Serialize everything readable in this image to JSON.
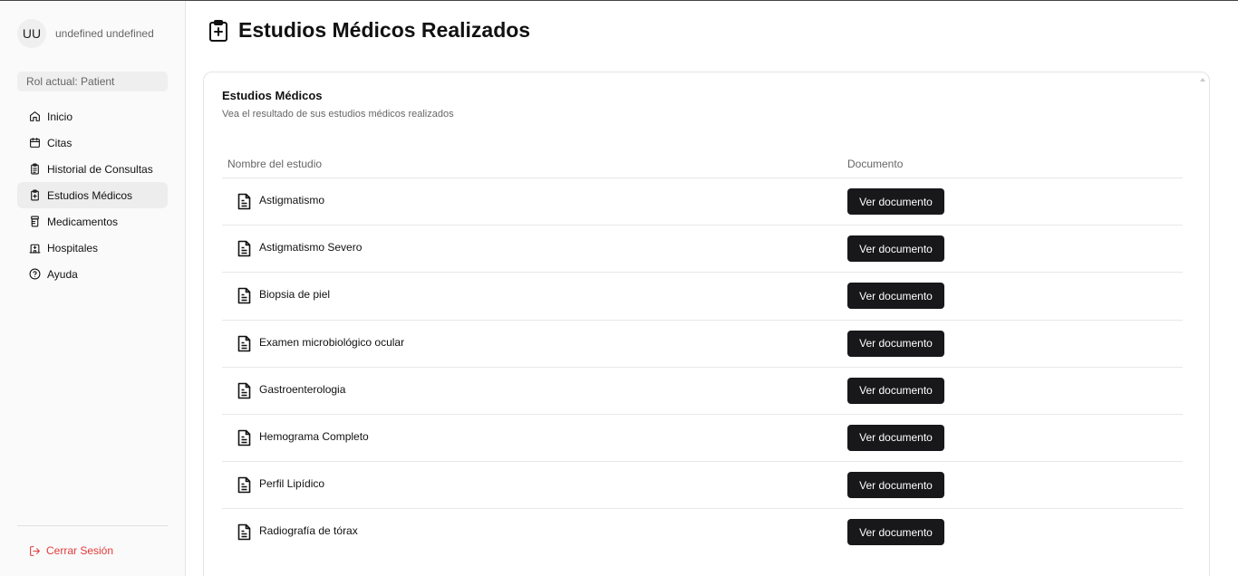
{
  "user": {
    "initials": "UU",
    "name": "undefined undefined"
  },
  "role_label": "Rol actual: Patient",
  "nav": [
    {
      "label": "Inicio",
      "icon": "home-icon",
      "active": false
    },
    {
      "label": "Citas",
      "icon": "calendar-icon",
      "active": false
    },
    {
      "label": "Historial de Consultas",
      "icon": "clipboard-list-icon",
      "active": false
    },
    {
      "label": "Estudios Médicos",
      "icon": "clipboard-plus-icon",
      "active": true
    },
    {
      "label": "Medicamentos",
      "icon": "pill-bottle-icon",
      "active": false
    },
    {
      "label": "Hospitales",
      "icon": "hospital-icon",
      "active": false
    },
    {
      "label": "Ayuda",
      "icon": "help-circle-icon",
      "active": false
    }
  ],
  "logout_label": "Cerrar Sesión",
  "page_title": "Estudios Médicos Realizados",
  "card": {
    "title": "Estudios Médicos",
    "subtitle": "Vea el resultado de sus estudios médicos realizados",
    "columns": [
      "Nombre del estudio",
      "Documento"
    ],
    "rows": [
      {
        "name": "Astigmatismo",
        "action": "Ver documento"
      },
      {
        "name": "Astigmatismo Severo",
        "action": "Ver documento"
      },
      {
        "name": "Biopsia de piel",
        "action": "Ver documento"
      },
      {
        "name": "Examen microbiológico ocular",
        "action": "Ver documento"
      },
      {
        "name": "Gastroenterologia",
        "action": "Ver documento"
      },
      {
        "name": "Hemograma Completo",
        "action": "Ver documento"
      },
      {
        "name": "Perfil Lipídico",
        "action": "Ver documento"
      },
      {
        "name": "Radiografía de tórax",
        "action": "Ver documento"
      }
    ]
  },
  "colors": {
    "accent_dark": "#18181b",
    "logout_red": "#e23b3b",
    "active_bg": "#ededed"
  }
}
